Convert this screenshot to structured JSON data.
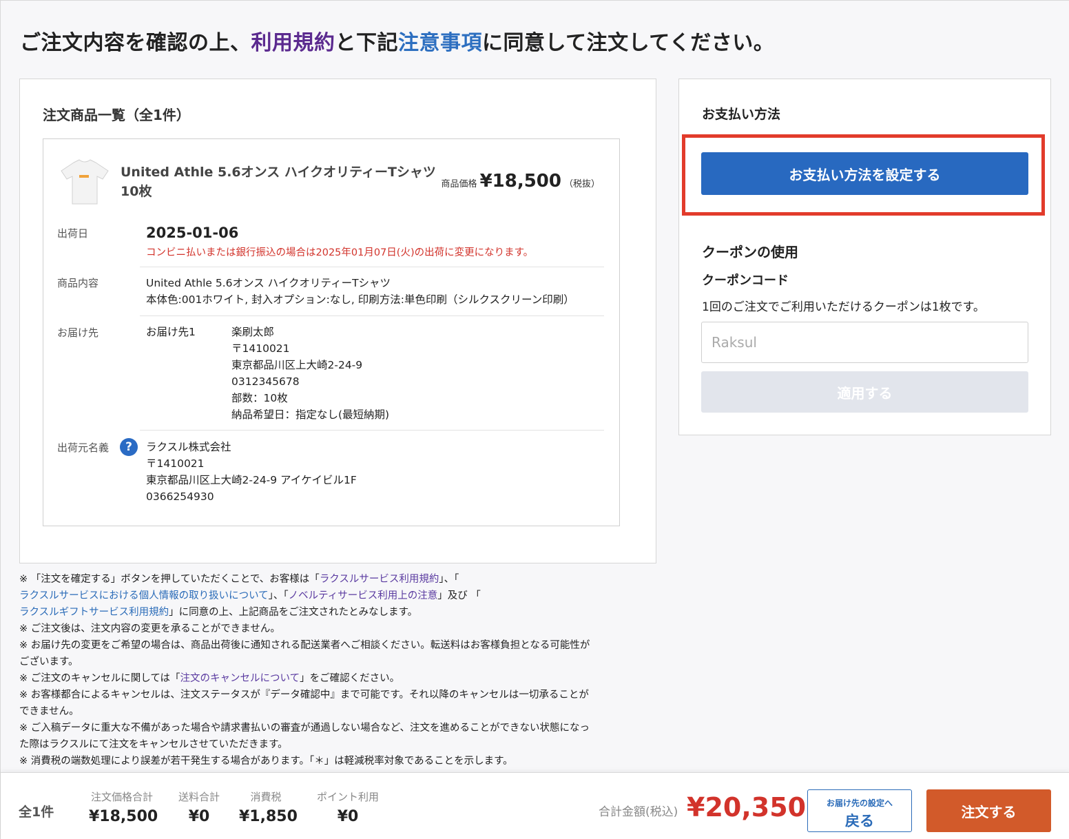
{
  "title": {
    "part1": "ご注文内容を確認の上、",
    "terms_link": "利用規約",
    "part2": "と下記",
    "notes_link": "注意事項",
    "part3": "に同意して注文してください。"
  },
  "order": {
    "heading": "注文商品一覧（全1件）",
    "item": {
      "name": "United Athle 5.6オンス ハイクオリティーTシャツ 10枚",
      "price_label": "商品価格",
      "price": "¥18,500",
      "tax_note": "（税抜）"
    },
    "ship_date_label": "出荷日",
    "ship_date": "2025-01-06",
    "ship_note": "コンビニ払いまたは銀行振込の場合は2025年01月07日(火)の出荷に変更になります。",
    "content_label": "商品内容",
    "content_lines": [
      "United Athle 5.6オンス ハイクオリティーTシャツ",
      "本体色:001ホワイト, 封入オプション:なし, 印刷方法:単色印刷（シルクスクリーン印刷）"
    ],
    "delivery_label": "お届け先",
    "delivery_name_label": "お届け先1",
    "delivery_lines": [
      "楽刷太郎",
      "〒1410021",
      "東京都品川区上大崎2-24-9",
      "0312345678",
      "部数：10枚",
      "納品希望日：指定なし(最短納期)"
    ],
    "sender_label": "出荷元名義",
    "sender_lines": [
      "ラクスル株式会社",
      "〒1410021",
      "東京都品川区上大崎2-24-9 アイケイビル1F",
      "0366254930"
    ],
    "help_icon_glyph": "?"
  },
  "notes": {
    "n1_a": "※ 「注文を確定する」ボタンを押していただくことで、お客様は「",
    "n1_link1": "ラクスルサービス利用規約",
    "n1_b": "」、「",
    "n1_link2": "ラクスルサービスにおける個人情報の取り扱いについて",
    "n1_c": "」、「",
    "n1_link3": "ノベルティサービス利用上の注意",
    "n1_d": "」及び 「",
    "n1_link4": "ラクスルギフトサービス利用規約",
    "n1_e": "」に同意の上、上記商品をご注文されたとみなします。",
    "n2": "※ ご注文後は、注文内容の変更を承ることができません。",
    "n3a": "※ お届け先の変更をご希望の場合は、商品出荷後に通知される配送業者へご相談ください。転送料はお客様負担となる可能性が",
    "n3b": "ございます。",
    "n4_a": "※ ご注文のキャンセルに関しては「",
    "n4_link": "注文のキャンセルについて",
    "n4_b": "」をご確認ください。",
    "n5a": "※ お客様都合によるキャンセルは、注文ステータスが『データ確認中』まで可能です。それ以降のキャンセルは一切承ることが",
    "n5b": "できません。",
    "n6a": "※ ご入稿データに重大な不備があった場合や請求書払いの審査が通過しない場合など、注文を進めることができない状態になっ",
    "n6b": "た際はラクスルにて注文をキャンセルさせていただきます。",
    "n7": "※ 消費税の端数処理により誤差が若干発生する場合があります。「＊」は軽減税率対象であることを示します。"
  },
  "payment": {
    "heading": "お支払い方法",
    "button": "お支払い方法を設定する"
  },
  "coupon": {
    "heading": "クーポンの使用",
    "code_label": "クーポンコード",
    "description": "1回のご注文でご利用いただけるクーポンは1枚です。",
    "placeholder": "Raksul",
    "apply_button": "適用する"
  },
  "footer": {
    "count": "全1件",
    "subtotal_label": "注文価格合計",
    "subtotal": "¥18,500",
    "shipping_label": "送料合計",
    "shipping": "¥0",
    "tax_label": "消費税",
    "tax": "¥1,850",
    "points_label": "ポイント利用",
    "points": "¥0",
    "total_label": "合計金額(税込)",
    "total": "¥20,350",
    "back_small": "お届け先の設定へ",
    "back_big": "戻る",
    "order_button": "注文する"
  },
  "colors": {
    "accent_blue": "#2869c0",
    "order_orange": "#d25a2a",
    "total_red": "#d2332b",
    "highlight_red": "#e23b2b"
  }
}
